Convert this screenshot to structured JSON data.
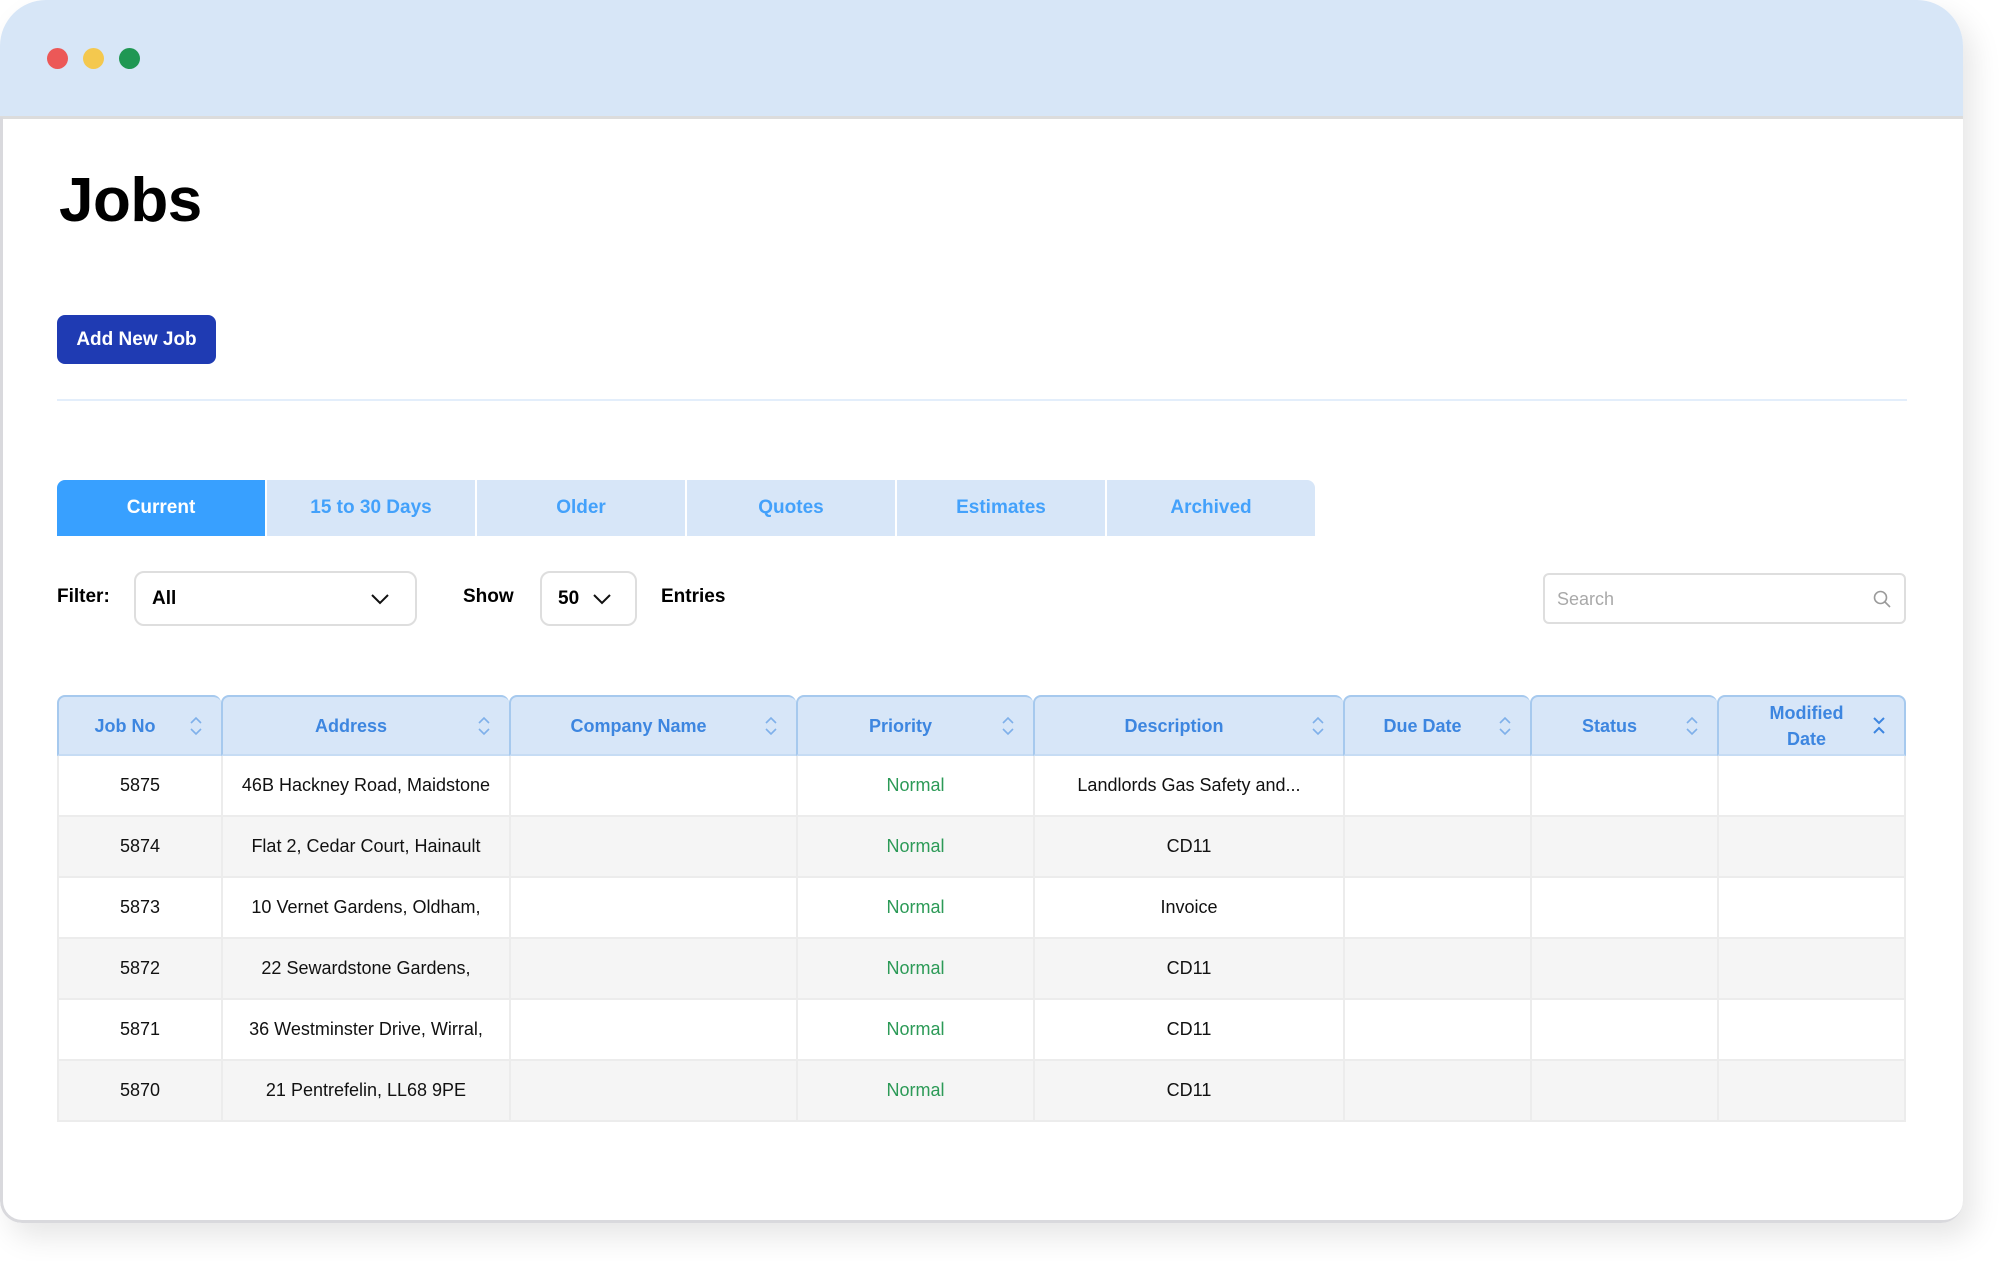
{
  "window": {
    "controls": [
      "close",
      "minimize",
      "maximize"
    ]
  },
  "page": {
    "title": "Jobs",
    "add_button_label": "Add New Job"
  },
  "tabs": [
    {
      "label": "Current",
      "active": true
    },
    {
      "label": "15 to 30 Days",
      "active": false
    },
    {
      "label": "Older",
      "active": false
    },
    {
      "label": "Quotes",
      "active": false
    },
    {
      "label": "Estimates",
      "active": false
    },
    {
      "label": "Archived",
      "active": false
    }
  ],
  "controls": {
    "filter_label": "Filter:",
    "filter_value": "All",
    "show_label": "Show",
    "show_value": "50",
    "entries_label": "Entries",
    "search_placeholder": "Search",
    "search_value": ""
  },
  "table": {
    "columns": [
      {
        "label": "Job No",
        "sort": "none"
      },
      {
        "label": "Address",
        "sort": "none"
      },
      {
        "label": "Company Name",
        "sort": "none"
      },
      {
        "label": "Priority",
        "sort": "none"
      },
      {
        "label": "Description",
        "sort": "none"
      },
      {
        "label": "Due Date",
        "sort": "none"
      },
      {
        "label": "Status",
        "sort": "none"
      },
      {
        "label": "Modified Date",
        "sort": "active"
      }
    ],
    "rows": [
      {
        "job_no": "5875",
        "address": "46B Hackney Road, Maidstone",
        "company": "",
        "priority": "Normal",
        "description": "Landlords Gas Safety and...",
        "due_date": "",
        "status": "",
        "modified": ""
      },
      {
        "job_no": "5874",
        "address": "Flat 2, Cedar Court, Hainault",
        "company": "",
        "priority": "Normal",
        "description": "CD11",
        "due_date": "",
        "status": "",
        "modified": ""
      },
      {
        "job_no": "5873",
        "address": "10 Vernet Gardens, Oldham,",
        "company": "",
        "priority": "Normal",
        "description": "Invoice",
        "due_date": "",
        "status": "",
        "modified": ""
      },
      {
        "job_no": "5872",
        "address": "22 Sewardstone Gardens,",
        "company": "",
        "priority": "Normal",
        "description": "CD11",
        "due_date": "",
        "status": "",
        "modified": ""
      },
      {
        "job_no": "5871",
        "address": "36 Westminster Drive, Wirral,",
        "company": "",
        "priority": "Normal",
        "description": "CD11",
        "due_date": "",
        "status": "",
        "modified": ""
      },
      {
        "job_no": "5870",
        "address": "21 Pentrefelin, LL68 9PE",
        "company": "",
        "priority": "Normal",
        "description": "CD11",
        "due_date": "",
        "status": "",
        "modified": ""
      }
    ]
  },
  "colors": {
    "titlebar": "#d7e6f7",
    "primary_button": "#1f3bb3",
    "tab_active": "#38a0ff",
    "tab_inactive": "#d7e6f8",
    "tab_text": "#43a1fb",
    "header_text": "#3d86e0",
    "priority_normal": "#2c9a57"
  }
}
